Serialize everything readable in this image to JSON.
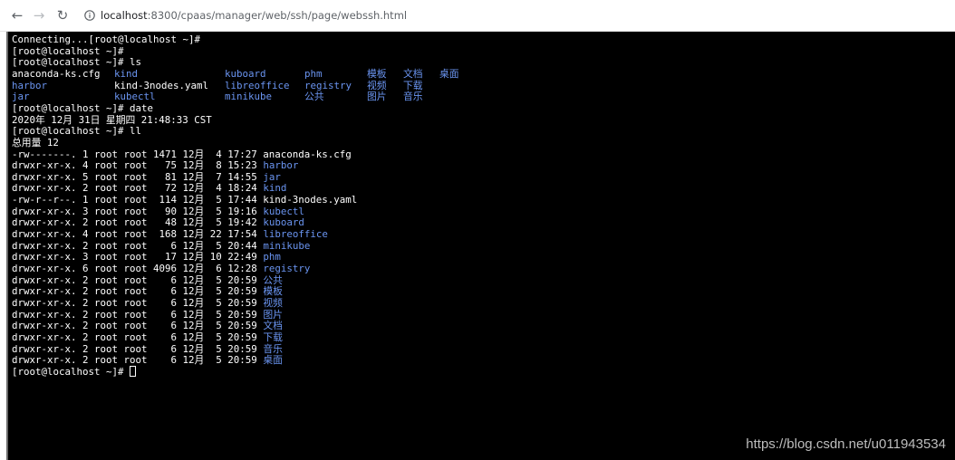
{
  "browser": {
    "url_host": "localhost",
    "url_path": ":8300/cpaas/manager/web/ssh/page/webssh.html",
    "icons": {
      "back": "back-arrow-icon",
      "forward": "forward-arrow-icon",
      "reload": "reload-icon",
      "info": "info-icon"
    }
  },
  "colors": {
    "terminal_bg": "#000000",
    "text": "#ffffff",
    "dir": "#6a94f0"
  },
  "terminal": {
    "lines": [
      {
        "t": "Connecting...[root@localhost ~]#"
      },
      {
        "t": "[root@localhost ~]#"
      },
      {
        "t": "[root@localhost ~]# ls"
      },
      {
        "t": "anaconda-ks.cfg"
      },
      {
        "t": "harbor",
        "blue": true
      },
      {
        "t": "jar",
        "blue": true
      },
      {
        "t": "[root@localhost ~]# date"
      },
      {
        "t": "2020年 12月 31日 星期四 21:48:33 CST"
      },
      {
        "t": "[root@localhost ~]# ll"
      },
      {
        "t": "总用量 12"
      },
      {
        "t": "-rw-------. 1 root root 1471 12月  4 17:27 anaconda-ks.cfg"
      },
      {
        "t": "drwxr-xr-x. 4 root root   75 12月  8 15:23 ",
        "name": "harbor"
      },
      {
        "t": "drwxr-xr-x. 5 root root   81 12月  7 14:55 ",
        "name": "jar"
      },
      {
        "t": "drwxr-xr-x. 2 root root   72 12月  4 18:24 ",
        "name": "kind"
      },
      {
        "t": "-rw-r--r--. 1 root root  114 12月  5 17:44 kind-3nodes.yaml"
      },
      {
        "t": "drwxr-xr-x. 3 root root   90 12月  5 19:16 ",
        "name": "kubectl"
      },
      {
        "t": "drwxr-xr-x. 2 root root   48 12月  5 19:42 ",
        "name": "kuboard"
      },
      {
        "t": "drwxr-xr-x. 4 root root  168 12月 22 17:54 ",
        "name": "libreoffice"
      },
      {
        "t": "drwxr-xr-x. 2 root root    6 12月  5 20:44 ",
        "name": "minikube"
      },
      {
        "t": "drwxr-xr-x. 3 root root   17 12月 10 22:49 ",
        "name": "phm"
      },
      {
        "t": "drwxr-xr-x. 6 root root 4096 12月  6 12:28 ",
        "name": "registry"
      },
      {
        "t": "drwxr-xr-x. 2 root root    6 12月  5 20:59 ",
        "name": "公共"
      },
      {
        "t": "drwxr-xr-x. 2 root root    6 12月  5 20:59 ",
        "name": "模板"
      },
      {
        "t": "drwxr-xr-x. 2 root root    6 12月  5 20:59 ",
        "name": "视频"
      },
      {
        "t": "drwxr-xr-x. 2 root root    6 12月  5 20:59 ",
        "name": "图片"
      },
      {
        "t": "drwxr-xr-x. 2 root root    6 12月  5 20:59 ",
        "name": "文档"
      },
      {
        "t": "drwxr-xr-x. 2 root root    6 12月  5 20:59 ",
        "name": "下载"
      },
      {
        "t": "drwxr-xr-x. 2 root root    6 12月  5 20:59 ",
        "name": "音乐"
      },
      {
        "t": "drwxr-xr-x. 2 root root    6 12月  5 20:59 ",
        "name": "桌面"
      },
      {
        "t": "[root@localhost ~]# ",
        "cursor": true
      }
    ],
    "ls_columns": [
      {
        "rows": [
          {
            "t": "kind",
            "blue": true
          },
          {
            "t": "kind-3nodes.yaml"
          },
          {
            "t": "kubectl",
            "blue": true
          }
        ]
      },
      {
        "rows": [
          {
            "t": "kuboard",
            "blue": true
          },
          {
            "t": "libreoffice",
            "blue": true
          },
          {
            "t": "minikube",
            "blue": true
          }
        ]
      },
      {
        "rows": [
          {
            "t": "phm",
            "blue": true
          },
          {
            "t": "registry",
            "blue": true
          },
          {
            "t": "公共",
            "blue": true
          }
        ]
      },
      {
        "rows": [
          {
            "t": "模板",
            "blue": true
          },
          {
            "t": "视频",
            "blue": true
          },
          {
            "t": "图片",
            "blue": true
          }
        ]
      },
      {
        "rows": [
          {
            "t": "文档",
            "blue": true
          },
          {
            "t": "下载",
            "blue": true
          },
          {
            "t": "音乐",
            "blue": true
          }
        ]
      },
      {
        "rows": [
          {
            "t": "桌面",
            "blue": true
          },
          {
            "t": ""
          },
          {
            "t": ""
          }
        ]
      }
    ]
  },
  "watermark": "https://blog.csdn.net/u011943534"
}
